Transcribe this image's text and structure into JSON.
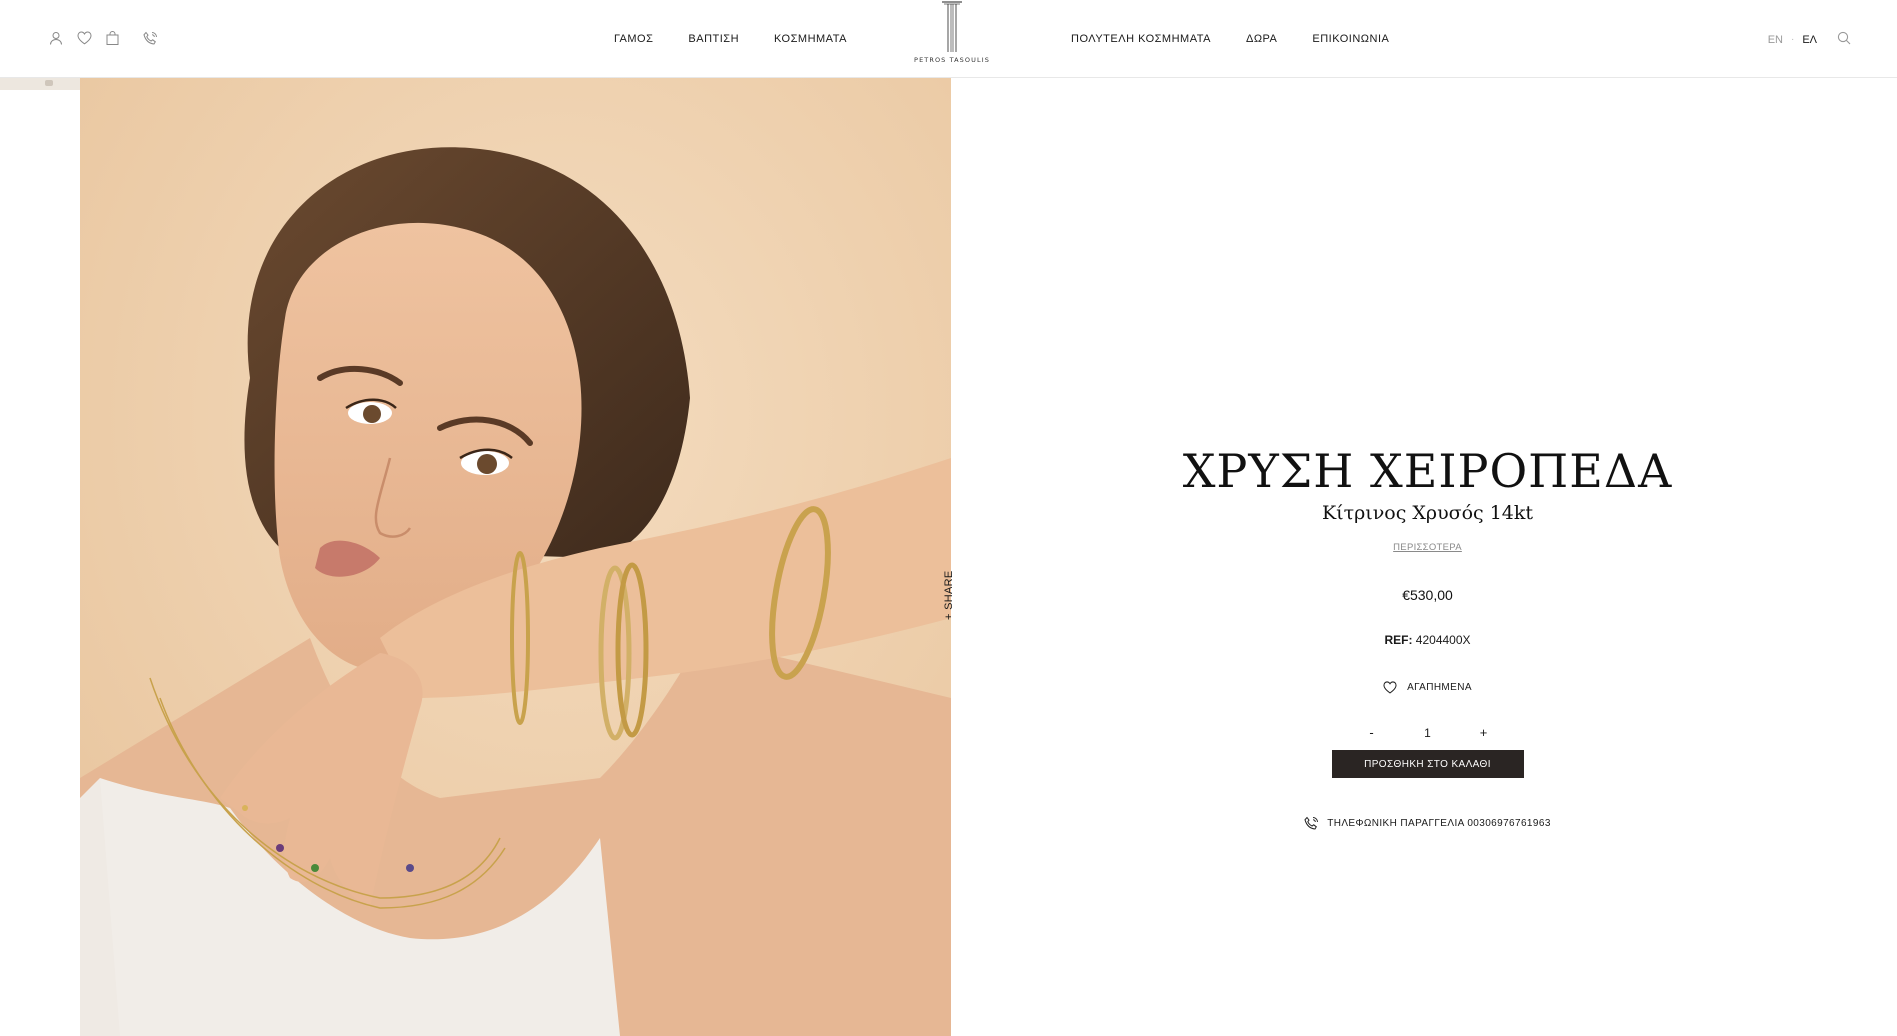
{
  "header": {
    "nav_left": [
      "ΓΑΜΟΣ",
      "ΒΑΠΤΙΣΗ",
      "ΚΟΣΜΗΜΑΤΑ"
    ],
    "nav_right": [
      "ΠΟΛΥΤΕΛΗ ΚΟΣΜΗΜΑΤΑ",
      "ΔΩΡΑ",
      "ΕΠΙΚΟΙΝΩΝΙΑ"
    ],
    "logo_text": "PETROS TASOULIS",
    "lang_en": "EN",
    "lang_separator": "·",
    "lang_el": "ΕΛ",
    "icons": [
      "user-icon",
      "heart-icon",
      "shopping-bag-icon",
      "phone-icon",
      "search-icon"
    ]
  },
  "product": {
    "share_label": "+ SHARE",
    "title": "ΧΡΥΣΗ ΧΕΙΡΟΠΕΔΑ",
    "subtitle": "Κίτρινος Χρυσός 14kt",
    "more_link": "ΠΕΡΙΣΣΟΤΕΡΑ",
    "price": "€530,00",
    "ref_label": "REF:",
    "ref_value": "4204400X",
    "favorites_label": "ΑΓΑΠΗΜΕΝΑ",
    "qty_minus": "-",
    "qty_value": "1",
    "qty_plus": "+",
    "add_to_cart": "ΠΡΟΣΘΗΚΗ ΣΤΟ ΚΑΛΑΘΙ",
    "phone_order": "ΤΗΛΕΦΩΝΙΚΗ ΠΑΡΑΓΓΕΛΙΑ 00306976761963"
  },
  "colors": {
    "accent_button": "#2a2523",
    "image_background": "#efd0ac",
    "muted_text": "#8a8a8a"
  }
}
